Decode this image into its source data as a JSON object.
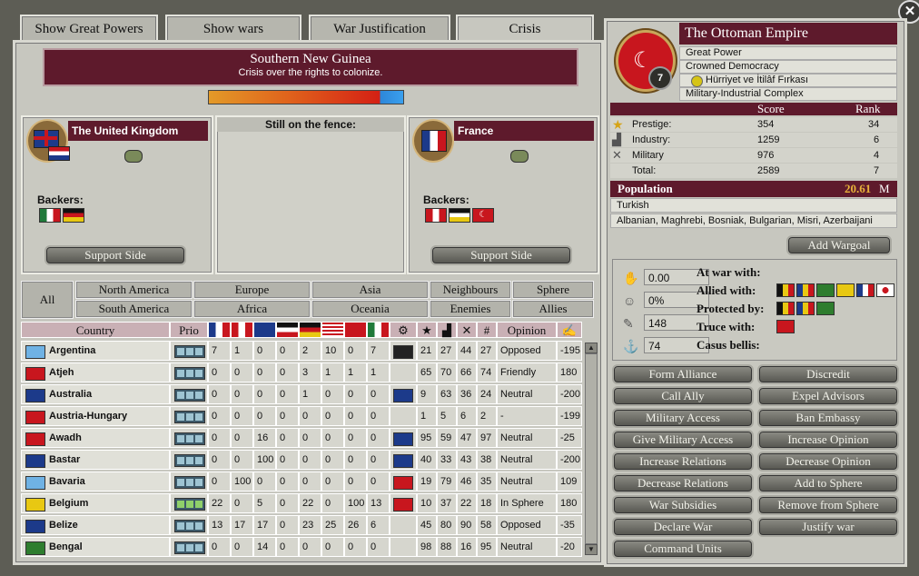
{
  "tabs": [
    {
      "label": "Show Great Powers"
    },
    {
      "label": "Show wars"
    },
    {
      "label": "War Justification"
    },
    {
      "label": "Crisis"
    }
  ],
  "crisis": {
    "title": "Southern New Guinea",
    "subtitle": "Crisis over the rights to colonize.",
    "progress_attacker_fraction": 0.88,
    "fence_title": "Still on the fence:",
    "backers_label": "Backers:",
    "support_label": "Support Side",
    "left": {
      "name": "The United Kingdom",
      "backers": [
        "mexico-flag",
        "germany-flag"
      ]
    },
    "right": {
      "name": "France",
      "backers": [
        "hungary-flag",
        "german-flag",
        "ottoman-flag"
      ]
    }
  },
  "filters": {
    "all": "All",
    "regions": [
      "North America",
      "Europe",
      "Asia",
      "Neighbours",
      "Sphere",
      "South America",
      "Africa",
      "Oceania",
      "Enemies",
      "Allies"
    ]
  },
  "table": {
    "headers": {
      "country": "Country",
      "prio": "Prio",
      "num": "#",
      "opinion": "Opinion"
    },
    "rows": [
      {
        "country": "Argentina",
        "flag": "#6fb2e4",
        "v": [
          "7",
          "1",
          "0",
          "0",
          "2",
          "10",
          "0",
          "7"
        ],
        "sphere": "#222",
        "s1": "21",
        "s2": "27",
        "s3": "44",
        "rank": "27",
        "opinion": "Opposed",
        "rel": "-195"
      },
      {
        "country": "Atjeh",
        "flag": "#c8161e",
        "v": [
          "0",
          "0",
          "0",
          "0",
          "3",
          "1",
          "1",
          "1"
        ],
        "sphere": "",
        "s1": "65",
        "s2": "70",
        "s3": "66",
        "rank": "74",
        "opinion": "Friendly",
        "rel": "180"
      },
      {
        "country": "Australia",
        "flag": "#1c3a8a",
        "v": [
          "0",
          "0",
          "0",
          "0",
          "1",
          "0",
          "0",
          "0"
        ],
        "sphere": "#1c3a8a",
        "s1": "9",
        "s2": "63",
        "s3": "36",
        "rank": "24",
        "opinion": "Neutral",
        "rel": "-200"
      },
      {
        "country": "Austria-Hungary",
        "flag": "#c8161e",
        "v": [
          "0",
          "0",
          "0",
          "0",
          "0",
          "0",
          "0",
          "0"
        ],
        "sphere": "",
        "s1": "1",
        "s2": "5",
        "s3": "6",
        "rank": "2",
        "opinion": "-",
        "rel": "-199"
      },
      {
        "country": "Awadh",
        "flag": "#c8161e",
        "v": [
          "0",
          "0",
          "16",
          "0",
          "0",
          "0",
          "0",
          "0"
        ],
        "sphere": "#1c3a8a",
        "s1": "95",
        "s2": "59",
        "s3": "47",
        "rank": "97",
        "opinion": "Neutral",
        "rel": "-25"
      },
      {
        "country": "Bastar",
        "flag": "#1c3a8a",
        "v": [
          "0",
          "0",
          "100",
          "0",
          "0",
          "0",
          "0",
          "0"
        ],
        "sphere": "#1c3a8a",
        "s1": "40",
        "s2": "33",
        "s3": "43",
        "rank": "38",
        "opinion": "Neutral",
        "rel": "-200"
      },
      {
        "country": "Bavaria",
        "flag": "#6fb2e4",
        "v": [
          "0",
          "100",
          "0",
          "0",
          "0",
          "0",
          "0",
          "0"
        ],
        "sphere": "#c8161e",
        "s1": "19",
        "s2": "79",
        "s3": "46",
        "rank": "35",
        "opinion": "Neutral",
        "rel": "109"
      },
      {
        "country": "Belgium",
        "flag": "#e8c812",
        "v": [
          "22",
          "0",
          "5",
          "0",
          "22",
          "0",
          "100",
          "13"
        ],
        "sphere": "#c8161e",
        "s1": "10",
        "s2": "37",
        "s3": "22",
        "rank": "18",
        "opinion": "In Sphere",
        "rel": "180"
      },
      {
        "country": "Belize",
        "flag": "#1c3a8a",
        "v": [
          "13",
          "17",
          "17",
          "0",
          "23",
          "25",
          "26",
          "6"
        ],
        "sphere": "",
        "s1": "45",
        "s2": "80",
        "s3": "90",
        "rank": "58",
        "opinion": "Opposed",
        "rel": "-35"
      },
      {
        "country": "Bengal",
        "flag": "#2e7d2e",
        "v": [
          "0",
          "0",
          "14",
          "0",
          "0",
          "0",
          "0",
          "0"
        ],
        "sphere": "",
        "s1": "98",
        "s2": "88",
        "s3": "16",
        "rank": "95",
        "opinion": "Neutral",
        "rel": "-20"
      }
    ]
  },
  "nation": {
    "name": "The Ottoman Empire",
    "rank_badge": "7",
    "status": "Great Power",
    "government": "Crowned Democracy",
    "party": "Hürriyet ve İtilâf Fırkası",
    "ideology": "Military-Industrial Complex",
    "score_header": "Score",
    "rank_header": "Rank",
    "scores": [
      {
        "label": "Prestige:",
        "score": "354",
        "rank": "34"
      },
      {
        "label": "Industry:",
        "score": "1259",
        "rank": "6"
      },
      {
        "label": "Military",
        "score": "976",
        "rank": "4"
      },
      {
        "label": "Total:",
        "score": "2589",
        "rank": "7"
      }
    ],
    "population_label": "Population",
    "population_value": "20.61",
    "population_unit": "M",
    "culture_primary": "Turkish",
    "cultures_accepted": "Albanian, Maghrebi, Bosniak, Bulgarian, Misri, Azerbaijani"
  },
  "relations": {
    "add_wargoal": "Add Wargoal",
    "stats": [
      "0.00",
      "0%",
      "148",
      "74"
    ],
    "labels": [
      "At war with:",
      "Allied with:",
      "Protected by:",
      "Truce with:",
      "Casus bellis:"
    ]
  },
  "actions": [
    "Form Alliance",
    "Discredit",
    "Call Ally",
    "Expel Advisors",
    "Military Access",
    "Ban Embassy",
    "Give Military Access",
    "Increase Opinion",
    "Increase Relations",
    "Decrease Opinion",
    "Decrease Relations",
    "Add to Sphere",
    "War Subsidies",
    "Remove from Sphere",
    "Declare War",
    "Justify war",
    "Command Units"
  ],
  "close_label": "✕"
}
